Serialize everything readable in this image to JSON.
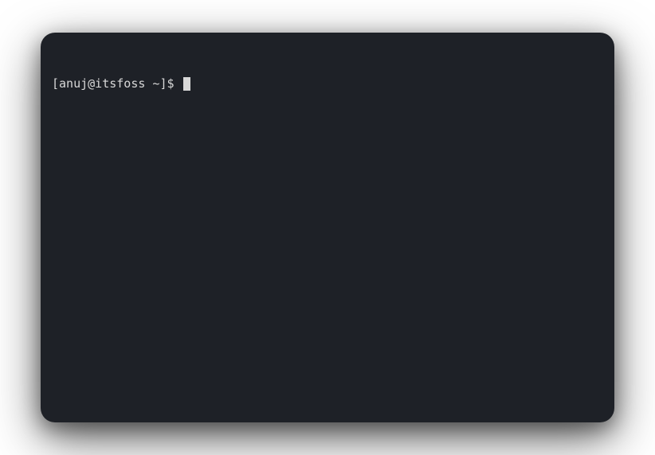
{
  "terminal": {
    "prompt": "[anuj@itsfoss ~]$ ",
    "input": ""
  }
}
